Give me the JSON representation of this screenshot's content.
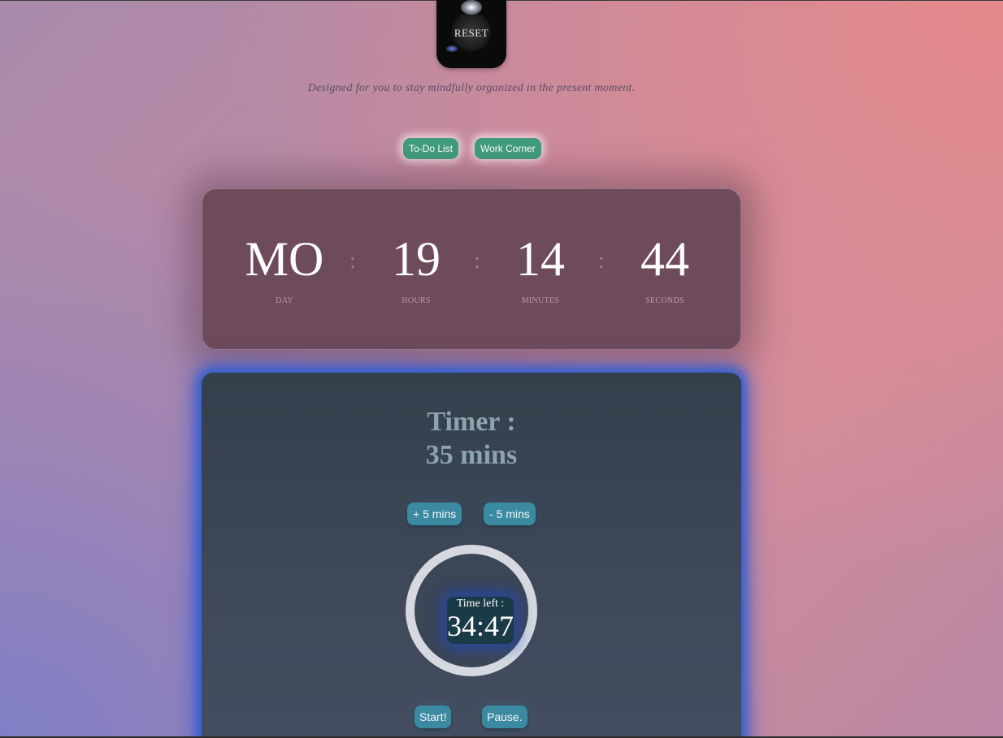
{
  "logo": {
    "text": "RESET"
  },
  "tagline": "Designed for you to stay mindfully organized in the present moment.",
  "nav": {
    "todo_label": "To-Do List",
    "work_label": "Work Corner"
  },
  "clock": {
    "day": "MO",
    "hours": "19",
    "minutes": "14",
    "seconds": "44",
    "separator": ":",
    "labels": {
      "day": "DAY",
      "hours": "HOURS",
      "minutes": "MINUTES",
      "seconds": "SECONDS"
    }
  },
  "timer": {
    "title_line1": "Timer :",
    "title_line2": "35 mins",
    "plus_label": "+ 5 mins",
    "minus_label": "- 5 mins",
    "time_left_label": "Time left :",
    "time_left_value": "34:47",
    "start_label": "Start!",
    "pause_label": "Pause."
  },
  "colors": {
    "nav_button": "#3f9d7c",
    "clock_card": "#6e4b5a",
    "timer_card": "#3b4656",
    "timer_glow": "#2f5fd6",
    "timer_button": "#3c8aa2",
    "ring": "#d6d9e0"
  }
}
